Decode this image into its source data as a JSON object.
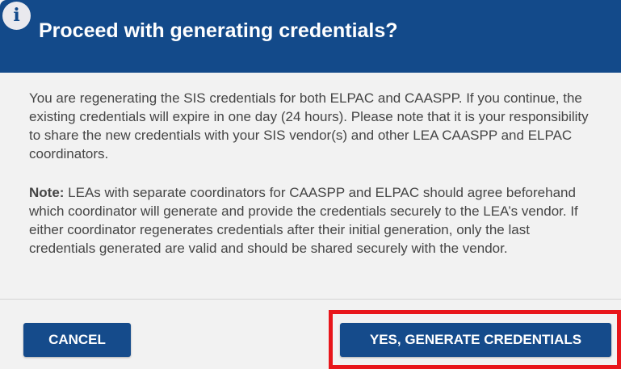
{
  "dialog": {
    "title": "Proceed with generating credentials?",
    "info_icon_glyph": "i",
    "paragraph1": "You are regenerating the SIS credentials for both ELPAC and CAASPP. If you continue, the existing credentials will expire in one day (24 hours). Please note that it is your responsibility to share the new credentials with your SIS vendor(s) and other LEA CAASPP and ELPAC coordinators.",
    "note_label": "Note:",
    "note_text": " LEAs with separate coordinators for CAASPP and ELPAC should agree beforehand which coordinator will generate and provide the credentials securely to the LEA’s vendor. If either coordinator regenerates credentials after their initial generation, only the last credentials generated are valid and should be shared securely with the vendor."
  },
  "buttons": {
    "cancel_label": "CANCEL",
    "confirm_label": "YES, GENERATE CREDENTIALS"
  },
  "colors": {
    "header": "#134a8a",
    "button": "#154b8b",
    "highlight": "#e8161b",
    "body_bg": "#f2f2f2",
    "text": "#454545"
  },
  "icons": {
    "header_icon": "info-icon"
  }
}
